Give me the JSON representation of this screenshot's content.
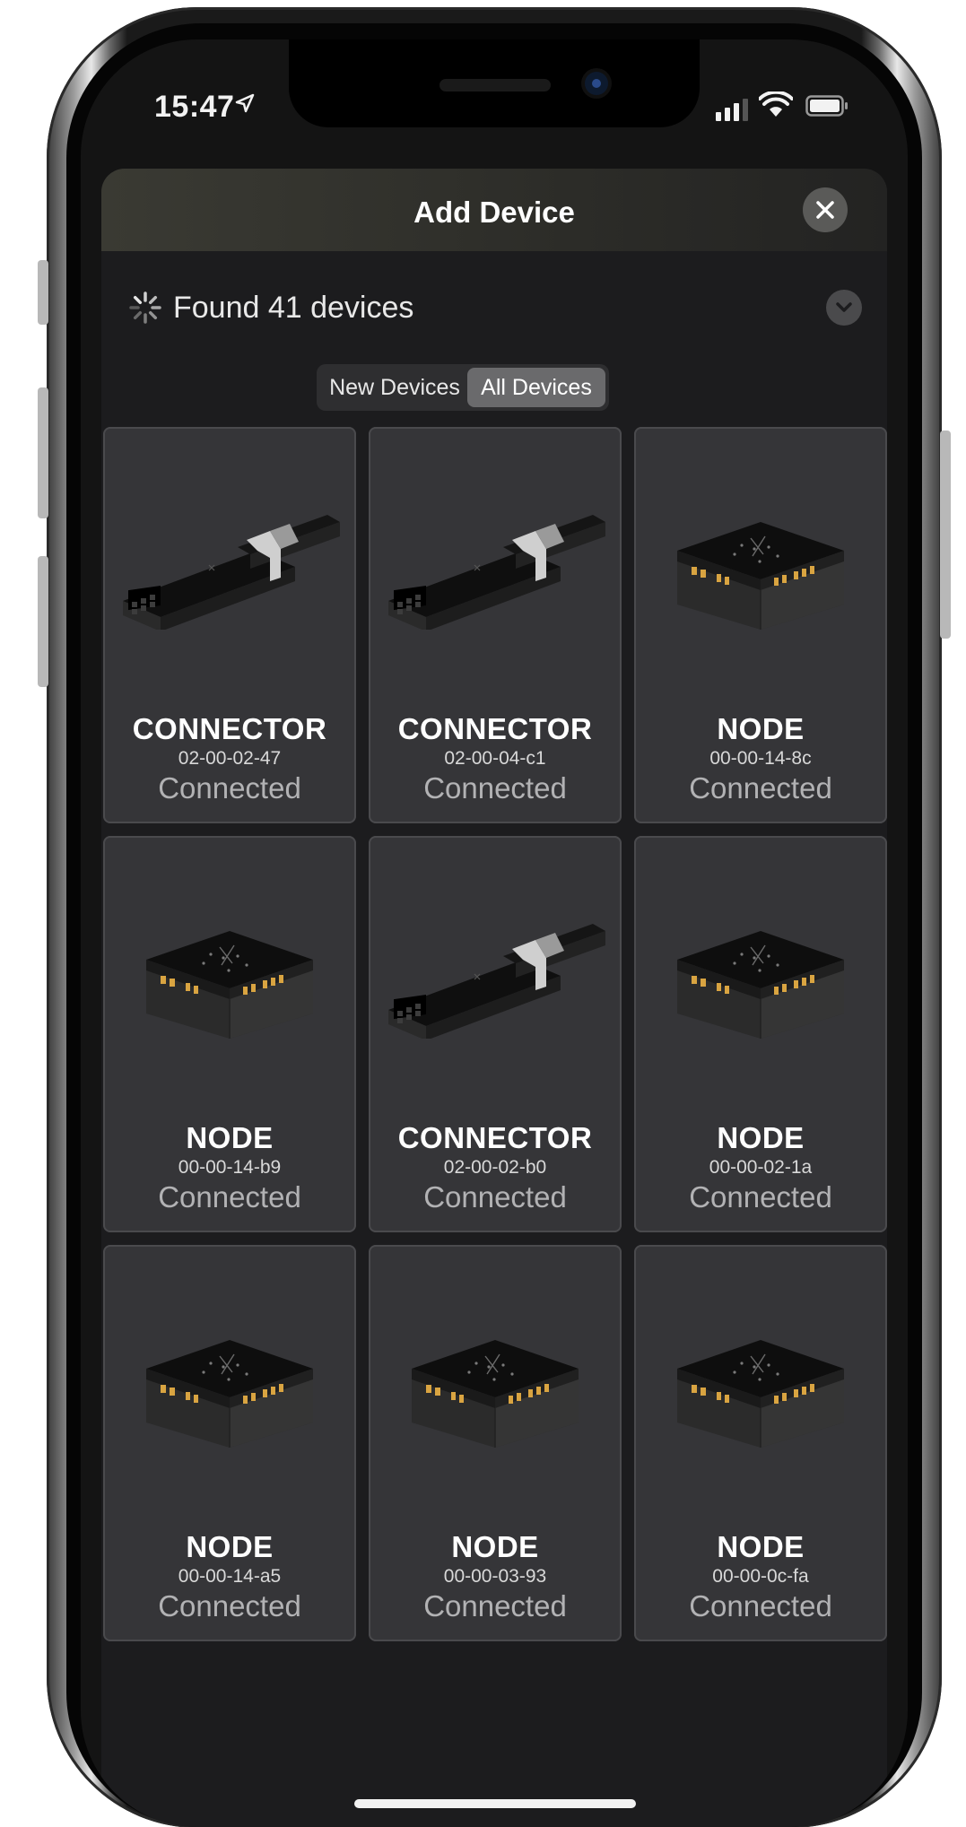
{
  "status_bar": {
    "time": "15:47"
  },
  "sheet": {
    "title": "Add Device",
    "found_text": "Found 41 devices"
  },
  "tabs": [
    {
      "label": "New Devices",
      "selected": false
    },
    {
      "label": "All Devices",
      "selected": true
    }
  ],
  "devices": [
    {
      "type": "CONNECTOR",
      "id": "02-00-02-47",
      "status": "Connected",
      "image": "connector-image"
    },
    {
      "type": "CONNECTOR",
      "id": "02-00-04-c1",
      "status": "Connected",
      "image": "connector-image"
    },
    {
      "type": "NODE",
      "id": "00-00-14-8c",
      "status": "Connected",
      "image": "node-image"
    },
    {
      "type": "NODE",
      "id": "00-00-14-b9",
      "status": "Connected",
      "image": "node-image"
    },
    {
      "type": "CONNECTOR",
      "id": "02-00-02-b0",
      "status": "Connected",
      "image": "connector-image"
    },
    {
      "type": "NODE",
      "id": "00-00-02-1a",
      "status": "Connected",
      "image": "node-image"
    },
    {
      "type": "NODE",
      "id": "00-00-14-a5",
      "status": "Connected",
      "image": "node-image"
    },
    {
      "type": "NODE",
      "id": "00-00-03-93",
      "status": "Connected",
      "image": "node-image"
    },
    {
      "type": "NODE",
      "id": "00-00-0c-fa",
      "status": "Connected",
      "image": "node-image"
    }
  ],
  "icons": {
    "close": "close-icon",
    "expand": "chevron-down-icon",
    "spinner": "loading-spinner-icon",
    "location": "location-arrow-icon",
    "signal": "cellular-signal-icon",
    "wifi": "wifi-icon",
    "battery": "battery-icon"
  },
  "colors": {
    "screen_bg": "#141414",
    "sheet_bg": "#1c1c1e",
    "card_bg": "#353538",
    "selected_tab": "#6a6a6c",
    "connector_pin": "#d9a441"
  }
}
